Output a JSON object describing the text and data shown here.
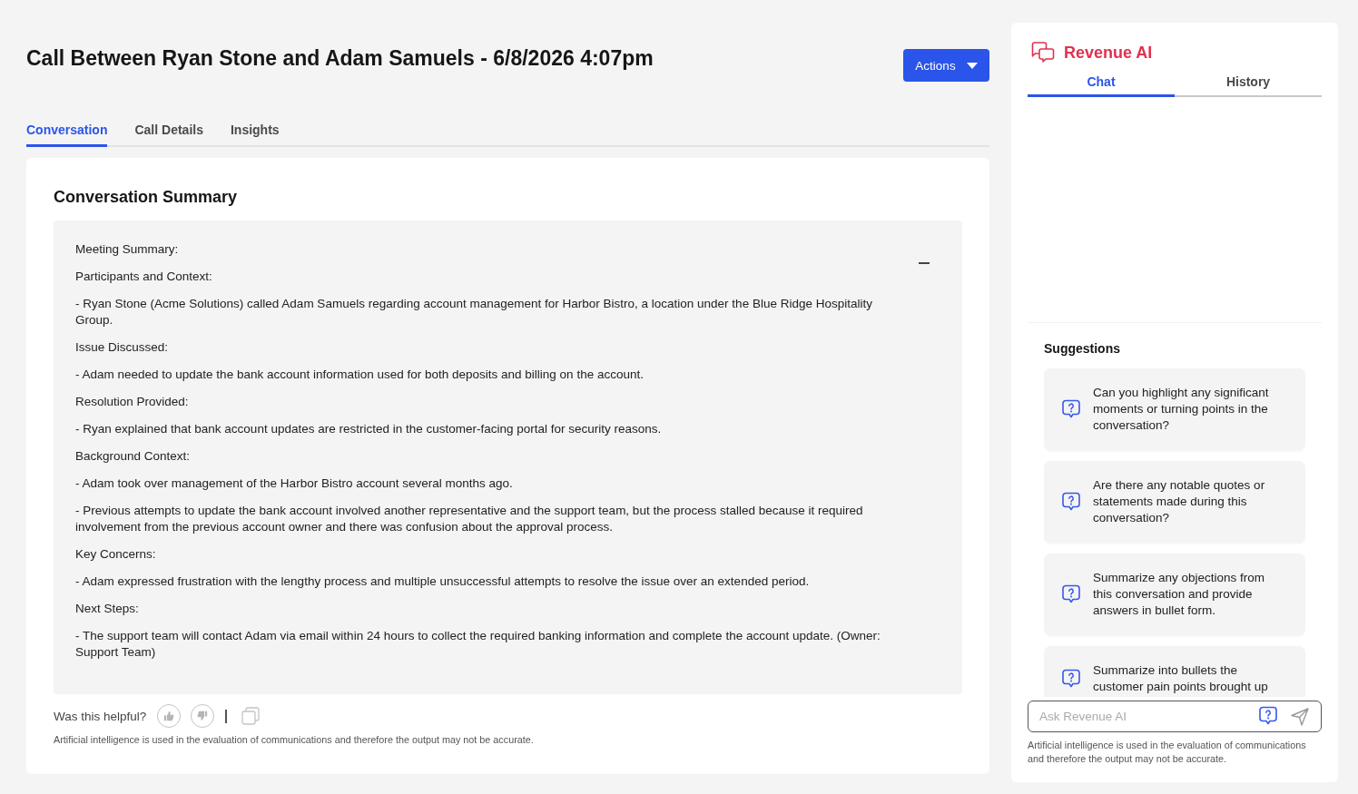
{
  "page": {
    "title": "Call Between Ryan Stone and Adam Samuels - 6/8/2026 4:07pm",
    "actions_button": "Actions"
  },
  "tabs": [
    {
      "label": "Conversation",
      "selected": true
    },
    {
      "label": "Call Details",
      "selected": false
    },
    {
      "label": "Insights",
      "selected": false
    }
  ],
  "summary": {
    "heading": "Conversation Summary",
    "expanded": true,
    "paragraphs": [
      "Meeting Summary:",
      "Participants and Context:",
      "- Ryan Stone (Acme Solutions) called Adam Samuels regarding account management for Harbor Bistro, a location under the Blue Ridge Hospitality Group.",
      "Issue Discussed:",
      "- Adam needed to update the bank account information used for both deposits and billing on the account.",
      "Resolution Provided:",
      "- Ryan explained that bank account updates are restricted in the customer-facing portal for security reasons.",
      "Background Context:",
      "- Adam took over management of the Harbor Bistro account several months ago.",
      "- Previous attempts to update the bank account involved another representative and the support team, but the process stalled because it required involvement from the previous account owner and there was confusion about the approval process.",
      "Key Concerns:",
      "- Adam expressed frustration with the lengthy process and multiple unsuccessful attempts to resolve the issue over an extended period.",
      "Next Steps:",
      "- The support team will contact Adam via email within 24 hours to collect the required banking information and complete the account update. (Owner: Support Team)"
    ]
  },
  "feedback": {
    "question": "Was this helpful?",
    "disclaimer": "Artificial intelligence is used in the evaluation of communications and therefore the output may not be accurate."
  },
  "assistant": {
    "title": "Revenue AI",
    "tabs": [
      {
        "label": "Chat",
        "selected": true
      },
      {
        "label": "History",
        "selected": false
      }
    ],
    "suggestions_heading": "Suggestions",
    "suggestions": [
      "Can you highlight any significant moments or turning points in the conversation?",
      "Are there any notable quotes or statements made during this conversation?",
      "Summarize any objections from this conversation and provide answers in bullet form.",
      "Summarize into bullets the customer pain points brought up"
    ],
    "input": {
      "placeholder": "Ask Revenue AI"
    },
    "disclaimer": "Artificial intelligence is used in the evaluation of communications and therefore the output may not be accurate."
  }
}
